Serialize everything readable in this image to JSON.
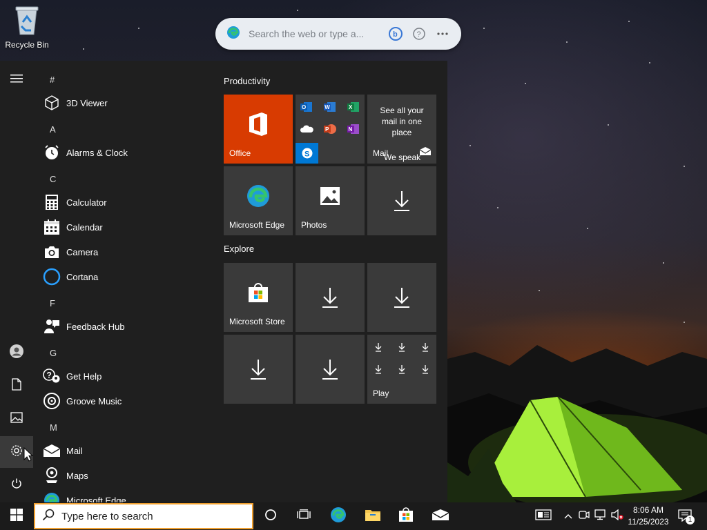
{
  "desktop": {
    "recycle_bin_label": "Recycle Bin"
  },
  "edge_search": {
    "placeholder": "Search the web or type a..."
  },
  "start_menu": {
    "letters": [
      "#",
      "A",
      "C",
      "F",
      "G",
      "M"
    ],
    "apps": [
      {
        "name": "3D Viewer",
        "icon": "cube-icon"
      },
      {
        "name": "Alarms & Clock",
        "icon": "alarm-clock-icon"
      },
      {
        "name": "Calculator",
        "icon": "calculator-icon"
      },
      {
        "name": "Calendar",
        "icon": "calendar-icon"
      },
      {
        "name": "Camera",
        "icon": "camera-icon"
      },
      {
        "name": "Cortana",
        "icon": "cortana-icon"
      },
      {
        "name": "Feedback Hub",
        "icon": "feedback-hub-icon"
      },
      {
        "name": "Get Help",
        "icon": "get-help-icon"
      },
      {
        "name": "Groove Music",
        "icon": "groove-music-icon"
      },
      {
        "name": "Mail",
        "icon": "mail-icon"
      },
      {
        "name": "Maps",
        "icon": "maps-icon"
      },
      {
        "name": "Microsoft Edge",
        "icon": "edge-icon"
      }
    ],
    "groups": {
      "productivity": "Productivity",
      "explore": "Explore"
    },
    "tiles": {
      "office": "Office",
      "mail_text": "See all your mail in one place",
      "mail_label": "Mail",
      "mail_overlay": "We speak",
      "edge": "Microsoft Edge",
      "photos": "Photos",
      "store": "Microsoft Store",
      "play": "Play"
    },
    "office_apps": [
      "O",
      "W",
      "X",
      "P",
      "N",
      "S"
    ]
  },
  "taskbar": {
    "search_placeholder": "Type here to search",
    "time": "8:06 AM",
    "date": "11/25/2023",
    "notification_count": "1"
  },
  "colors": {
    "office_orange": "#d83b01",
    "tile_gray": "#3a3a3a",
    "menu_bg": "#1f1f1f",
    "taskbar_bg": "#1b1b1b",
    "search_border": "#f0a030"
  }
}
